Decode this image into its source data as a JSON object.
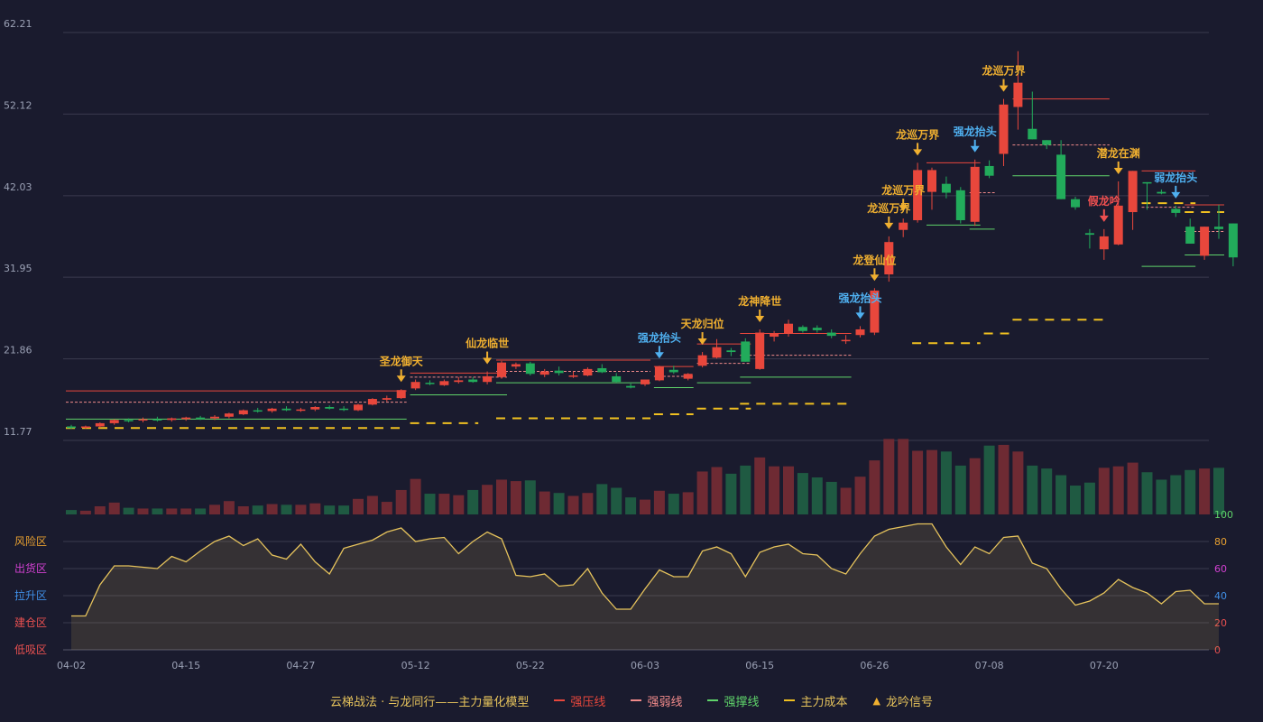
{
  "colors": {
    "background": "#1a1b2e",
    "grid": "#3a3b4e",
    "up": "#e8473c",
    "down": "#22ab5b",
    "vol_up": "#6e2a33",
    "vol_down": "#1f5a42",
    "strong_press": "#e8473c",
    "weak_line": "#f08a8a",
    "support": "#5fd36a",
    "cost": "#f0c020",
    "sentiment": "#e6c35c",
    "signal_gold": "#f0b030",
    "signal_blue": "#4fb0f0",
    "signal_red": "#f05050"
  },
  "chart_data": [
    {
      "type": "candlestick",
      "y_ticks": [
        "62.21",
        "52.12",
        "42.03",
        "31.95",
        "21.86",
        "11.77"
      ],
      "ylim": [
        11.77,
        62.21
      ],
      "x_ticks": [
        {
          "i": 0,
          "label": "04-02"
        },
        {
          "i": 8,
          "label": "04-15"
        },
        {
          "i": 16,
          "label": "04-27"
        },
        {
          "i": 24,
          "label": "05-12"
        },
        {
          "i": 32,
          "label": "05-22"
        },
        {
          "i": 40,
          "label": "06-03"
        },
        {
          "i": 48,
          "label": "06-15"
        },
        {
          "i": 56,
          "label": "06-26"
        },
        {
          "i": 64,
          "label": "07-08"
        },
        {
          "i": 72,
          "label": "07-20"
        }
      ],
      "ohlc": [
        [
          13.5,
          13.7,
          13.2,
          13.3
        ],
        [
          13.4,
          13.6,
          13.2,
          13.5
        ],
        [
          13.5,
          14.0,
          13.3,
          13.9
        ],
        [
          13.9,
          14.4,
          13.7,
          14.3
        ],
        [
          14.3,
          14.5,
          14.0,
          14.2
        ],
        [
          14.3,
          14.6,
          14.0,
          14.4
        ],
        [
          14.4,
          14.7,
          14.1,
          14.3
        ],
        [
          14.3,
          14.6,
          14.1,
          14.5
        ],
        [
          14.4,
          14.7,
          14.2,
          14.6
        ],
        [
          14.6,
          14.8,
          14.3,
          14.4
        ],
        [
          14.5,
          14.9,
          14.3,
          14.7
        ],
        [
          14.7,
          15.2,
          14.5,
          15.1
        ],
        [
          15.0,
          15.6,
          14.9,
          15.5
        ],
        [
          15.5,
          15.8,
          15.2,
          15.4
        ],
        [
          15.4,
          15.8,
          15.2,
          15.7
        ],
        [
          15.7,
          16.0,
          15.4,
          15.5
        ],
        [
          15.5,
          15.8,
          15.3,
          15.6
        ],
        [
          15.6,
          16.0,
          15.4,
          15.9
        ],
        [
          15.9,
          16.1,
          15.6,
          15.7
        ],
        [
          15.7,
          16.0,
          15.4,
          15.6
        ],
        [
          15.5,
          16.3,
          15.4,
          16.2
        ],
        [
          16.2,
          17.0,
          16.1,
          16.9
        ],
        [
          16.8,
          17.3,
          16.6,
          17.0
        ],
        [
          17.0,
          18.1,
          16.9,
          18.0
        ],
        [
          18.2,
          19.3,
          18.0,
          19.0
        ],
        [
          18.9,
          19.2,
          18.6,
          18.8
        ],
        [
          18.6,
          19.3,
          18.5,
          19.1
        ],
        [
          19.0,
          19.6,
          18.8,
          19.2
        ],
        [
          19.3,
          19.6,
          18.9,
          19.0
        ],
        [
          19.0,
          20.3,
          18.7,
          19.7
        ],
        [
          19.6,
          21.6,
          19.4,
          21.4
        ],
        [
          20.9,
          21.4,
          20.6,
          21.2
        ],
        [
          21.3,
          21.5,
          19.8,
          20.0
        ],
        [
          19.9,
          20.6,
          19.6,
          20.3
        ],
        [
          20.4,
          20.9,
          19.8,
          20.1
        ],
        [
          19.8,
          20.3,
          19.5,
          19.8
        ],
        [
          19.8,
          20.8,
          19.7,
          20.6
        ],
        [
          20.7,
          21.2,
          20.1,
          20.2
        ],
        [
          19.7,
          20.1,
          18.9,
          19.0
        ],
        [
          18.5,
          18.8,
          18.2,
          18.3
        ],
        [
          18.7,
          19.2,
          18.5,
          19.3
        ],
        [
          19.2,
          21.0,
          19.1,
          20.9
        ],
        [
          20.5,
          21.0,
          20.0,
          20.2
        ],
        [
          19.4,
          20.1,
          19.2,
          20.0
        ],
        [
          21.0,
          22.7,
          20.8,
          22.3
        ],
        [
          22.0,
          24.3,
          21.9,
          23.3
        ],
        [
          22.9,
          23.2,
          22.2,
          22.7
        ],
        [
          24.0,
          24.4,
          21.5,
          21.5
        ],
        [
          20.6,
          25.5,
          20.5,
          25.1
        ],
        [
          24.6,
          25.3,
          24.0,
          25.0
        ],
        [
          25.0,
          26.7,
          24.6,
          26.2
        ],
        [
          25.8,
          26.0,
          25.1,
          25.3
        ],
        [
          25.7,
          26.0,
          25.1,
          25.4
        ],
        [
          25.1,
          25.5,
          24.4,
          24.7
        ],
        [
          24.2,
          24.8,
          23.7,
          24.2
        ],
        [
          24.8,
          25.9,
          24.5,
          25.5
        ],
        [
          25.1,
          30.6,
          24.8,
          30.3
        ],
        [
          32.3,
          37.0,
          31.4,
          36.3
        ],
        [
          37.8,
          39.2,
          36.9,
          38.7
        ],
        [
          39.0,
          46.1,
          38.7,
          45.2
        ],
        [
          42.5,
          45.5,
          40.3,
          45.2
        ],
        [
          43.5,
          44.4,
          41.7,
          42.4
        ],
        [
          42.7,
          43.1,
          38.6,
          39.0
        ],
        [
          38.8,
          46.5,
          38.3,
          45.6
        ],
        [
          45.7,
          46.4,
          44.2,
          44.5
        ],
        [
          47.2,
          54.0,
          45.7,
          53.3
        ],
        [
          53.0,
          59.9,
          50.2,
          56.0
        ],
        [
          50.3,
          54.9,
          49.0,
          49.0
        ],
        [
          48.9,
          48.7,
          47.8,
          48.3
        ],
        [
          47.1,
          48.9,
          41.6,
          41.6
        ],
        [
          41.6,
          41.9,
          40.3,
          40.6
        ],
        [
          37.4,
          37.9,
          35.5,
          37.2
        ],
        [
          35.4,
          37.9,
          34.1,
          37.0
        ],
        [
          36.0,
          43.8,
          35.9,
          40.8
        ],
        [
          40.0,
          41.6,
          37.8,
          45.1
        ],
        [
          43.7,
          43.7,
          40.3,
          43.6
        ],
        [
          42.5,
          42.8,
          42.2,
          42.3
        ],
        [
          40.4,
          40.8,
          39.4,
          39.9
        ],
        [
          38.2,
          39.2,
          36.1,
          36.1
        ],
        [
          34.6,
          36.4,
          34.1,
          38.2
        ],
        [
          38.2,
          40.9,
          36.7,
          37.9
        ],
        [
          38.6,
          38.6,
          33.3,
          34.4
        ]
      ],
      "level_segments": [
        {
          "kind": "press",
          "from": 0,
          "to": 23,
          "y": 17.9
        },
        {
          "kind": "weak",
          "from": 0,
          "to": 23,
          "y": 16.5
        },
        {
          "kind": "support",
          "from": 0,
          "to": 23,
          "y": 14.4
        },
        {
          "kind": "cost",
          "from": 0,
          "to": 23,
          "y": 13.3
        },
        {
          "kind": "press",
          "from": 24,
          "to": 30,
          "y": 20.1
        },
        {
          "kind": "weak",
          "from": 24,
          "to": 30,
          "y": 19.6
        },
        {
          "kind": "support",
          "from": 24,
          "to": 30,
          "y": 17.4
        },
        {
          "kind": "cost",
          "from": 24,
          "to": 28,
          "y": 13.9
        },
        {
          "kind": "press",
          "from": 30,
          "to": 40,
          "y": 21.7
        },
        {
          "kind": "weak",
          "from": 30,
          "to": 40,
          "y": 20.3
        },
        {
          "kind": "support",
          "from": 30,
          "to": 40,
          "y": 18.9
        },
        {
          "kind": "cost",
          "from": 30,
          "to": 40,
          "y": 14.5
        },
        {
          "kind": "press",
          "from": 41,
          "to": 43,
          "y": 20.9
        },
        {
          "kind": "weak",
          "from": 41,
          "to": 43,
          "y": 19.7
        },
        {
          "kind": "support",
          "from": 41,
          "to": 43,
          "y": 18.3
        },
        {
          "kind": "cost",
          "from": 41,
          "to": 43,
          "y": 15.0
        },
        {
          "kind": "press",
          "from": 44,
          "to": 47,
          "y": 23.7
        },
        {
          "kind": "weak",
          "from": 44,
          "to": 47,
          "y": 21.3
        },
        {
          "kind": "support",
          "from": 44,
          "to": 47,
          "y": 18.9
        },
        {
          "kind": "cost",
          "from": 44,
          "to": 47,
          "y": 15.7
        },
        {
          "kind": "press",
          "from": 47,
          "to": 54,
          "y": 25.0
        },
        {
          "kind": "weak",
          "from": 47,
          "to": 54,
          "y": 22.3
        },
        {
          "kind": "support",
          "from": 47,
          "to": 54,
          "y": 19.6
        },
        {
          "kind": "cost",
          "from": 47,
          "to": 54,
          "y": 16.3
        },
        {
          "kind": "cost",
          "from": 59,
          "to": 63,
          "y": 23.8
        },
        {
          "kind": "press",
          "from": 60,
          "to": 63,
          "y": 46.1
        },
        {
          "kind": "support",
          "from": 60,
          "to": 63,
          "y": 38.4
        },
        {
          "kind": "weak",
          "from": 63,
          "to": 64,
          "y": 42.4
        },
        {
          "kind": "support",
          "from": 63,
          "to": 64,
          "y": 37.9
        },
        {
          "kind": "cost",
          "from": 64,
          "to": 65,
          "y": 25.0
        },
        {
          "kind": "press",
          "from": 66,
          "to": 72,
          "y": 54.0
        },
        {
          "kind": "weak",
          "from": 66,
          "to": 72,
          "y": 48.3
        },
        {
          "kind": "support",
          "from": 66,
          "to": 72,
          "y": 44.5
        },
        {
          "kind": "cost",
          "from": 66,
          "to": 72,
          "y": 26.7
        },
        {
          "kind": "press",
          "from": 75,
          "to": 78,
          "y": 45.1
        },
        {
          "kind": "weak",
          "from": 75,
          "to": 78,
          "y": 40.6
        },
        {
          "kind": "support",
          "from": 75,
          "to": 78,
          "y": 33.3
        },
        {
          "kind": "cost",
          "from": 75,
          "to": 78,
          "y": 41.1
        },
        {
          "kind": "press",
          "from": 78,
          "to": 80,
          "y": 40.9
        },
        {
          "kind": "weak",
          "from": 78,
          "to": 80,
          "y": 37.6
        },
        {
          "kind": "support",
          "from": 78,
          "to": 80,
          "y": 34.7
        },
        {
          "kind": "cost",
          "from": 78,
          "to": 80,
          "y": 40.0
        }
      ],
      "signals": [
        {
          "i": 23,
          "label": "圣龙御天",
          "color": "gold"
        },
        {
          "i": 29,
          "label": "仙龙临世",
          "color": "gold"
        },
        {
          "i": 41,
          "label": "强龙抬头",
          "color": "blue"
        },
        {
          "i": 44,
          "label": "天龙归位",
          "color": "gold"
        },
        {
          "i": 48,
          "label": "龙神降世",
          "color": "gold"
        },
        {
          "i": 55,
          "label": "强龙抬头",
          "color": "blue"
        },
        {
          "i": 56,
          "label": "龙登仙位",
          "color": "gold"
        },
        {
          "i": 57,
          "label": "龙巡万界",
          "color": "gold"
        },
        {
          "i": 58,
          "label": "龙巡万界",
          "color": "gold"
        },
        {
          "i": 59,
          "label": "龙巡万界",
          "color": "gold"
        },
        {
          "i": 63,
          "label": "强龙抬头",
          "color": "blue"
        },
        {
          "i": 65,
          "label": "龙巡万界",
          "color": "gold"
        },
        {
          "i": 72,
          "label": "假龙吟",
          "color": "red"
        },
        {
          "i": 73,
          "label": "潜龙在渊",
          "color": "gold"
        },
        {
          "i": 77,
          "label": "弱龙抬头",
          "color": "blue"
        }
      ]
    },
    {
      "type": "bar",
      "title": "",
      "values": [
        0.6,
        0.5,
        1.1,
        1.6,
        0.9,
        0.8,
        0.8,
        0.8,
        0.8,
        0.8,
        1.3,
        1.8,
        1.1,
        1.2,
        1.4,
        1.3,
        1.3,
        1.5,
        1.2,
        1.2,
        2.1,
        2.5,
        1.7,
        3.3,
        4.8,
        2.8,
        2.8,
        2.6,
        3.3,
        4.0,
        4.7,
        4.5,
        4.6,
        3.1,
        2.9,
        2.5,
        2.9,
        4.1,
        3.6,
        2.3,
        2.0,
        3.2,
        2.8,
        3.0,
        5.8,
        6.4,
        5.5,
        6.6,
        7.7,
        6.5,
        6.5,
        5.6,
        5.0,
        4.4,
        3.6,
        5.1,
        7.3,
        10.2,
        10.2,
        8.6,
        8.7,
        8.5,
        6.6,
        7.6,
        9.3,
        9.4,
        8.5,
        6.6,
        6.2,
        5.3,
        3.9,
        4.3,
        6.3,
        6.5,
        7.0,
        5.7,
        4.7,
        5.3,
        6.0,
        6.2,
        6.3
      ],
      "ylim": [
        0,
        10
      ]
    },
    {
      "type": "area",
      "right_ticks": [
        "100",
        "80",
        "60",
        "40",
        "20",
        "0"
      ],
      "left_labels": [
        "风险区",
        "出货区",
        "拉升区",
        "建仓区",
        "低吸区"
      ],
      "ylim": [
        0,
        100
      ],
      "values": [
        25,
        25,
        48,
        62,
        62,
        61,
        60,
        69,
        65,
        73,
        80,
        84,
        77,
        82,
        70,
        67,
        78,
        65,
        56,
        75,
        78,
        81,
        87,
        90,
        80,
        82,
        83,
        71,
        80,
        87,
        82,
        55,
        54,
        56,
        47,
        48,
        60,
        42,
        30,
        30,
        45,
        59,
        54,
        54,
        73,
        76,
        71,
        54,
        72,
        76,
        78,
        71,
        70,
        60,
        56,
        71,
        84,
        89,
        91,
        93,
        93,
        76,
        63,
        76,
        71,
        83,
        84,
        64,
        60,
        45,
        33,
        36,
        42,
        52,
        46,
        42,
        34,
        43,
        44,
        34,
        34
      ]
    }
  ],
  "legend": {
    "title": "云梯战法 · 与龙同行——主力量化模型",
    "press": "强压线",
    "weak": "强弱线",
    "support": "强撑线",
    "cost": "主力成本",
    "signal": "龙吟信号",
    "signal_glyph": "▲"
  }
}
